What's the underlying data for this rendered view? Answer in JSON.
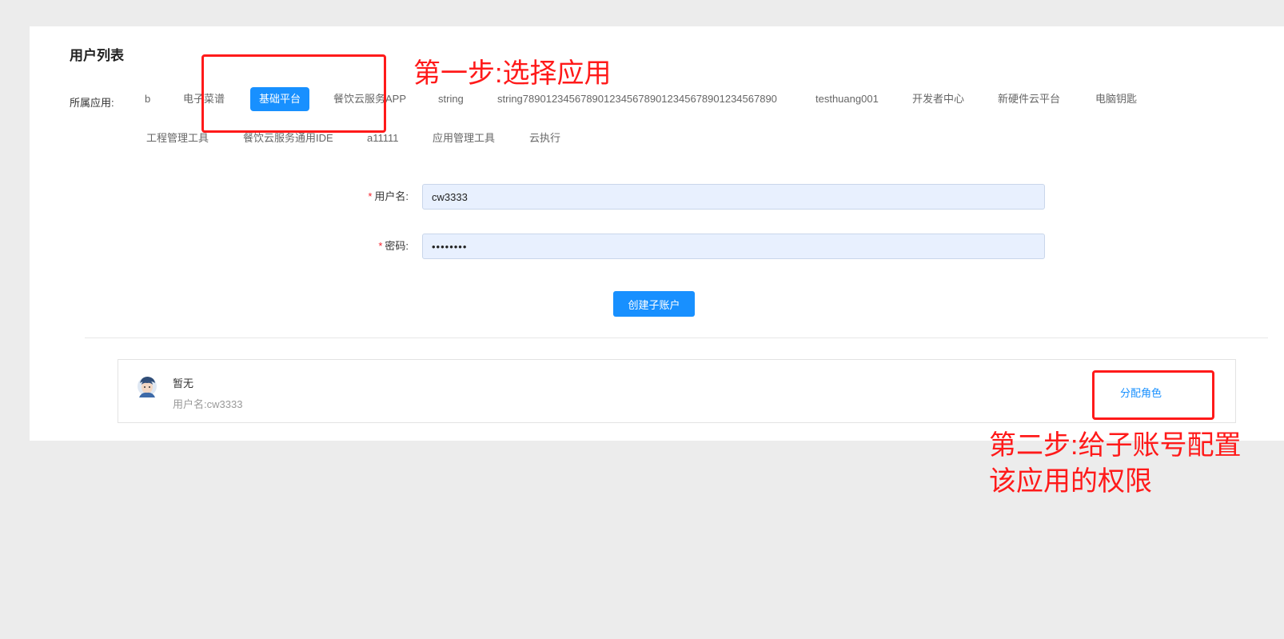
{
  "page": {
    "title": "用户列表",
    "app_label": "所属应用:"
  },
  "apps": [
    {
      "label": "b",
      "active": false
    },
    {
      "label": "电子菜谱",
      "active": false
    },
    {
      "label": "基础平台",
      "active": true
    },
    {
      "label": "餐饮云服务APP",
      "active": false
    },
    {
      "label": "string",
      "active": false
    },
    {
      "label": "string78901234567890123456789012345678901234567890",
      "active": false
    },
    {
      "label": "testhuang001",
      "active": false
    },
    {
      "label": "开发者中心",
      "active": false
    },
    {
      "label": "新硬件云平台",
      "active": false
    },
    {
      "label": "电脑钥匙",
      "active": false
    },
    {
      "label": "工程管理工具",
      "active": false
    },
    {
      "label": "餐饮云服务通用IDE",
      "active": false
    },
    {
      "label": "a11111",
      "active": false
    },
    {
      "label": "应用管理工具",
      "active": false
    },
    {
      "label": "云执行",
      "active": false
    }
  ],
  "form": {
    "required_mark": "*",
    "username_label": "用户名:",
    "username_value": "cw3333",
    "password_label": "密码:",
    "password_value": "••••••••",
    "submit_label": "创建子账户"
  },
  "user_list": [
    {
      "name": "暂无",
      "subtitle": "用户名:cw3333",
      "action": "分配角色"
    }
  ],
  "annotations": {
    "step1": "第一步:选择应用",
    "step2_line1": "第二步:给子账号配置",
    "step2_line2": "该应用的权限"
  },
  "colors": {
    "primary": "#1890ff",
    "annotation": "#ff1a1a",
    "background": "#ececec",
    "input_fill": "#e8f0fe"
  }
}
